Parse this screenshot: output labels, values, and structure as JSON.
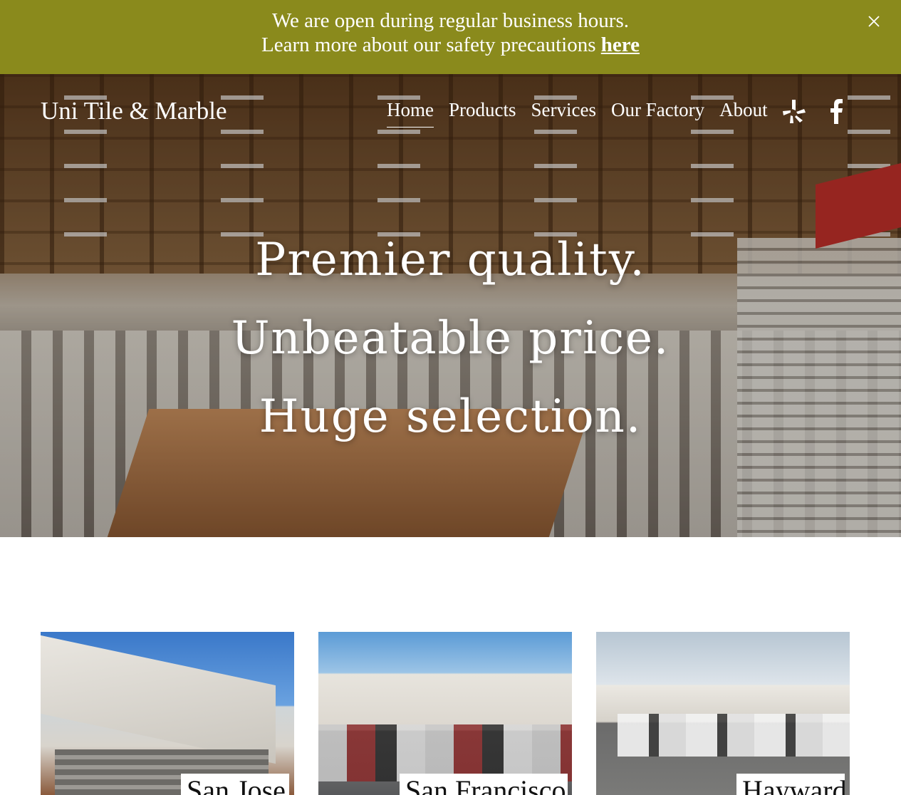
{
  "announcement": {
    "line1": "We are open during regular business hours.",
    "line2_prefix": "Learn more about our safety precautions ",
    "link_text": "here",
    "background": "#8a8a1c"
  },
  "header": {
    "site_title": "Uni Tile & Marble",
    "nav": [
      "Home",
      "Products",
      "Services",
      "Our Factory",
      "About"
    ],
    "active_nav": "Home",
    "social": [
      "yelp-icon",
      "facebook-icon"
    ]
  },
  "hero": {
    "lines": [
      "Premier quality.",
      "Unbeatable price.",
      "Huge selection."
    ]
  },
  "locations": [
    {
      "label": "San Jose"
    },
    {
      "label": "San Francisco"
    },
    {
      "label": "Hayward"
    }
  ]
}
